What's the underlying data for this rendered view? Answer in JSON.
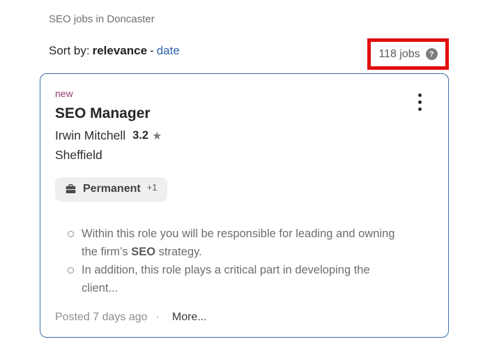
{
  "header": {
    "title": "SEO jobs in Doncaster"
  },
  "sort_bar": {
    "label": "Sort by:",
    "active_option": "relevance",
    "separator": "-",
    "inactive_option": "date",
    "jobs_count": "118 jobs",
    "help_glyph": "?"
  },
  "job_card": {
    "new_label": "new",
    "title": "SEO Manager",
    "company": "Irwin Mitchell",
    "rating": "3.2",
    "star_glyph": "★",
    "location": "Sheffield",
    "job_type": {
      "label": "Permanent",
      "extra": "+1"
    },
    "snippets": [
      {
        "text_before": "Within this role you will be responsible for leading and owning the firm’s ",
        "bold": "SEO",
        "text_after": " strategy."
      },
      {
        "text_before": "In addition, this role plays a critical part in developing the client...",
        "bold": "",
        "text_after": ""
      }
    ],
    "posted": "Posted 7 days ago",
    "footer_separator": "·",
    "more_label": "More..."
  },
  "colors": {
    "accent_red": "#e10d0d",
    "card_border_blue": "#3a6da8",
    "link_blue": "#2d62b0",
    "new_purple": "#943d6d"
  }
}
